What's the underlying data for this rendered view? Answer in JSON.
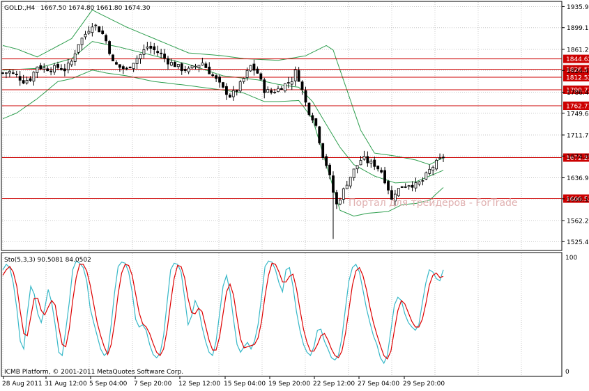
{
  "header": {
    "symbol": "GOLD.,H4",
    "ohlc": "1667.50 1674.80 1661.80 1674.30"
  },
  "indicator": {
    "label": "Sto(5,3,3) 90.5081 84.0502",
    "scale_max": "100",
    "scale_min": "0"
  },
  "copyright": "ICMB Platform, © 2001-2011 MetaQuotes Software Corp.",
  "watermark": "Портал для трейдеров - ForTrade",
  "colors": {
    "background": "#ffffff",
    "grid": "#c8c8c8",
    "candle": "#000000",
    "bollinger": "#2e9e4e",
    "level_line": "#cc0000",
    "level_tag_bg": "#cc0000",
    "stoch_main": "#37b8c8",
    "stoch_signal": "#dd0000",
    "watermark": "#e0b0b0"
  },
  "chart_data": [
    {
      "type": "candlestick",
      "title": "GOLD.,H4",
      "ylim": [
        1510,
        1945
      ],
      "y_ticks": [
        "1935.95",
        "1899.15",
        "1861.20",
        "1824.40",
        "1786.45",
        "1749.65",
        "1711.70",
        "1674.90",
        "1636.95",
        "1600.15",
        "1562.20",
        "1525.40"
      ],
      "x_ticks": [
        "28 Aug 2011",
        "31 Aug 12:00",
        "5 Sep 04:00",
        "7 Sep 20:00",
        "12 Sep 12:00",
        "15 Sep 04:00",
        "19 Sep 20:00",
        "22 Sep 12:00",
        "27 Sep 04:00",
        "29 Sep 20:00"
      ],
      "horizontal_levels": [
        "1844.62",
        "1826.57",
        "1812.52",
        "1790.73",
        "1762.71",
        "1672.23",
        "1600.53"
      ],
      "close_path": [
        [
          0,
          1820
        ],
        [
          2,
          1822
        ],
        [
          4,
          1815
        ],
        [
          6,
          1806
        ],
        [
          8,
          1810
        ],
        [
          10,
          1832
        ],
        [
          12,
          1828
        ],
        [
          14,
          1827
        ],
        [
          16,
          1830
        ],
        [
          18,
          1826
        ],
        [
          20,
          1840
        ],
        [
          22,
          1872
        ],
        [
          24,
          1888
        ],
        [
          26,
          1905
        ],
        [
          27,
          1902
        ],
        [
          28,
          1895
        ],
        [
          29,
          1888
        ],
        [
          30,
          1876
        ],
        [
          31,
          1858
        ],
        [
          32,
          1838
        ],
        [
          34,
          1830
        ],
        [
          36,
          1826
        ],
        [
          38,
          1840
        ],
        [
          40,
          1852
        ],
        [
          42,
          1866
        ],
        [
          44,
          1860
        ],
        [
          46,
          1852
        ],
        [
          48,
          1840
        ],
        [
          50,
          1834
        ],
        [
          52,
          1827
        ],
        [
          54,
          1825
        ],
        [
          56,
          1832
        ],
        [
          58,
          1838
        ],
        [
          60,
          1822
        ],
        [
          62,
          1808
        ],
        [
          64,
          1792
        ],
        [
          66,
          1780
        ],
        [
          68,
          1790
        ],
        [
          70,
          1810
        ],
        [
          72,
          1832
        ],
        [
          74,
          1820
        ],
        [
          76,
          1790
        ],
        [
          78,
          1786
        ],
        [
          80,
          1792
        ],
        [
          82,
          1800
        ],
        [
          84,
          1808
        ],
        [
          85,
          1822
        ],
        [
          86,
          1810
        ],
        [
          87,
          1790
        ],
        [
          88,
          1768
        ],
        [
          89,
          1752
        ],
        [
          90,
          1742
        ],
        [
          91,
          1728
        ],
        [
          92,
          1702
        ],
        [
          93,
          1676
        ],
        [
          94,
          1660
        ],
        [
          95,
          1638
        ],
        [
          96,
          1612
        ],
        [
          97,
          1590
        ],
        [
          98,
          1602
        ],
        [
          100,
          1628
        ],
        [
          102,
          1650
        ],
        [
          104,
          1668
        ],
        [
          105,
          1670
        ],
        [
          106,
          1665
        ],
        [
          108,
          1660
        ],
        [
          110,
          1648
        ],
        [
          112,
          1618
        ],
        [
          113,
          1598
        ],
        [
          114,
          1612
        ],
        [
          116,
          1622
        ],
        [
          118,
          1626
        ],
        [
          120,
          1624
        ],
        [
          122,
          1632
        ],
        [
          124,
          1650
        ],
        [
          126,
          1663
        ],
        [
          128,
          1674
        ]
      ],
      "bollinger_middle": [
        [
          0,
          1825
        ],
        [
          10,
          1828
        ],
        [
          20,
          1845
        ],
        [
          26,
          1875
        ],
        [
          34,
          1865
        ],
        [
          44,
          1850
        ],
        [
          54,
          1835
        ],
        [
          64,
          1815
        ],
        [
          74,
          1808
        ],
        [
          80,
          1800
        ],
        [
          86,
          1795
        ],
        [
          90,
          1770
        ],
        [
          94,
          1730
        ],
        [
          98,
          1690
        ],
        [
          102,
          1660
        ],
        [
          108,
          1640
        ],
        [
          114,
          1628
        ],
        [
          120,
          1630
        ],
        [
          128,
          1650
        ]
      ],
      "bollinger_upper": [
        [
          0,
          1868
        ],
        [
          4,
          1862
        ],
        [
          10,
          1848
        ],
        [
          20,
          1880
        ],
        [
          26,
          1930
        ],
        [
          30,
          1918
        ],
        [
          36,
          1900
        ],
        [
          44,
          1880
        ],
        [
          54,
          1855
        ],
        [
          64,
          1850
        ],
        [
          70,
          1845
        ],
        [
          80,
          1842
        ],
        [
          88,
          1850
        ],
        [
          94,
          1868
        ],
        [
          96,
          1860
        ],
        [
          100,
          1790
        ],
        [
          104,
          1720
        ],
        [
          108,
          1680
        ],
        [
          114,
          1675
        ],
        [
          120,
          1668
        ],
        [
          124,
          1660
        ],
        [
          128,
          1672
        ]
      ],
      "bollinger_lower": [
        [
          0,
          1740
        ],
        [
          4,
          1750
        ],
        [
          10,
          1775
        ],
        [
          16,
          1805
        ],
        [
          20,
          1810
        ],
        [
          26,
          1825
        ],
        [
          30,
          1820
        ],
        [
          36,
          1815
        ],
        [
          44,
          1805
        ],
        [
          54,
          1798
        ],
        [
          64,
          1790
        ],
        [
          70,
          1785
        ],
        [
          76,
          1770
        ],
        [
          80,
          1770
        ],
        [
          86,
          1772
        ],
        [
          90,
          1740
        ],
        [
          94,
          1660
        ],
        [
          98,
          1580
        ],
        [
          102,
          1570
        ],
        [
          106,
          1575
        ],
        [
          112,
          1578
        ],
        [
          116,
          1590
        ],
        [
          120,
          1592
        ],
        [
          124,
          1598
        ],
        [
          128,
          1620
        ]
      ]
    },
    {
      "type": "line",
      "title": "Sto(5,3,3)",
      "ylim": [
        0,
        100
      ],
      "y_ticks": [
        "100",
        "0"
      ],
      "series": [
        {
          "name": "Sto main",
          "values": [
            90,
            95,
            92,
            78,
            55,
            25,
            18,
            50,
            75,
            68,
            50,
            42,
            55,
            72,
            60,
            40,
            15,
            12,
            35,
            60,
            90,
            98,
            96,
            92,
            80,
            55,
            42,
            30,
            18,
            12,
            15,
            40,
            70,
            93,
            97,
            96,
            88,
            70,
            45,
            38,
            40,
            35,
            22,
            13,
            10,
            14,
            30,
            60,
            90,
            96,
            95,
            88,
            65,
            40,
            48,
            62,
            55,
            38,
            25,
            15,
            12,
            25,
            50,
            75,
            85,
            70,
            45,
            22,
            15,
            20,
            24,
            18,
            25,
            40,
            65,
            93,
            98,
            97,
            90,
            78,
            70,
            90,
            92,
            75,
            52,
            35,
            22,
            15,
            12,
            20,
            35,
            36,
            25,
            18,
            10,
            8,
            12,
            28,
            55,
            80,
            92,
            95,
            88,
            72,
            55,
            42,
            30,
            22,
            10,
            5,
            12,
            35,
            58,
            65,
            62,
            50,
            42,
            38,
            35,
            40,
            60,
            78,
            90,
            88,
            82,
            80,
            90
          ]
        },
        {
          "name": "Sto signal",
          "values": [
            85,
            90,
            93,
            88,
            75,
            52,
            32,
            30,
            47,
            64,
            64,
            53,
            49,
            56,
            62,
            58,
            38,
            22,
            20,
            36,
            62,
            83,
            95,
            95,
            89,
            76,
            59,
            42,
            30,
            20,
            13,
            22,
            42,
            68,
            87,
            95,
            94,
            85,
            68,
            51,
            41,
            38,
            32,
            23,
            15,
            12,
            18,
            35,
            60,
            82,
            94,
            93,
            83,
            64,
            51,
            50,
            55,
            52,
            39,
            26,
            17,
            17,
            29,
            50,
            70,
            77,
            67,
            46,
            27,
            19,
            20,
            21,
            22,
            28,
            43,
            66,
            85,
            96,
            95,
            88,
            79,
            79,
            84,
            86,
            73,
            54,
            36,
            24,
            16,
            16,
            22,
            30,
            32,
            26,
            18,
            12,
            10,
            16,
            32,
            54,
            76,
            89,
            92,
            85,
            72,
            56,
            42,
            31,
            21,
            12,
            9,
            16,
            35,
            53,
            62,
            59,
            51,
            43,
            38,
            38,
            45,
            59,
            76,
            85,
            87,
            83,
            84
          ]
        }
      ]
    }
  ]
}
